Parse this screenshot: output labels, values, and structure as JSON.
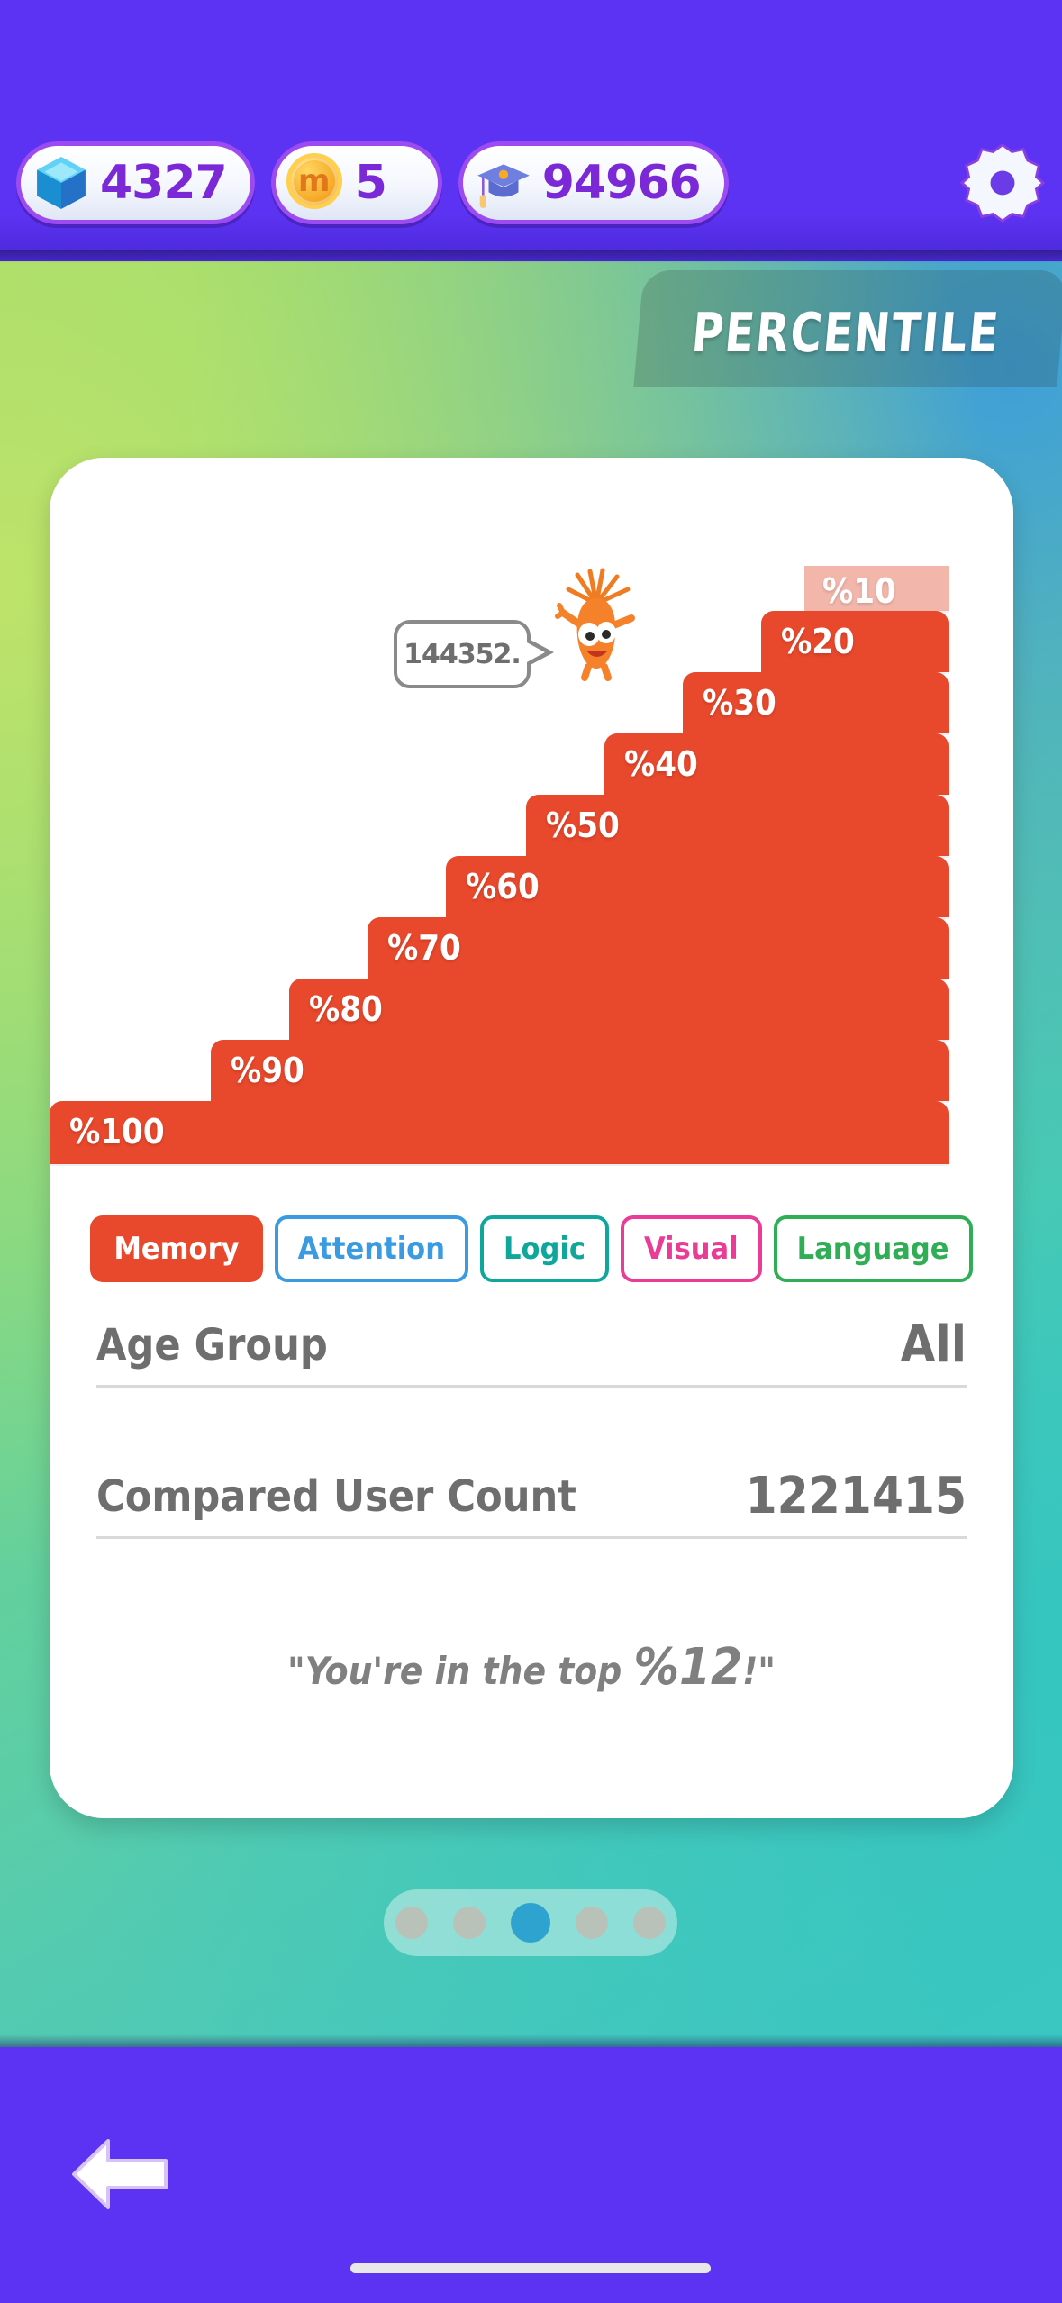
{
  "hud": {
    "gem": {
      "icon": "gem-icon",
      "value": "4327"
    },
    "coin": {
      "icon": "coin-icon",
      "glyph": "m",
      "value": "5"
    },
    "cap": {
      "icon": "graduation-cap-icon",
      "value": "94966"
    },
    "settings": {
      "icon": "gear-icon"
    }
  },
  "header": {
    "title": "PERCENTILE"
  },
  "chart_data": {
    "type": "bar",
    "title": "PERCENTILE",
    "orientation": "staircase",
    "categories": [
      "%10",
      "%20",
      "%30",
      "%40",
      "%50",
      "%60",
      "%70",
      "%80",
      "%90",
      "%100"
    ],
    "values": [
      10,
      20,
      30,
      40,
      50,
      60,
      70,
      80,
      90,
      100
    ],
    "highlight_category": "%10",
    "bar_color": "#E8482C",
    "faded_color": "#F3B6AB",
    "label_color": "#FFFFFF",
    "annotation": {
      "text": "144352.",
      "attached_to": "%10"
    },
    "xlabel": "",
    "ylabel": "",
    "grid": false,
    "legend": "none"
  },
  "bubble": {
    "text": "144352."
  },
  "mascot": {
    "icon": "carrot-mascot-icon"
  },
  "tabs": [
    {
      "label": "Memory",
      "color": "#E8482C",
      "active": true
    },
    {
      "label": "Attention",
      "color": "#3A9BE0",
      "active": false
    },
    {
      "label": "Logic",
      "color": "#0FA79B",
      "active": false
    },
    {
      "label": "Visual",
      "color": "#EA3C96",
      "active": false
    },
    {
      "label": "Language",
      "color": "#2FAE56",
      "active": false
    }
  ],
  "info": {
    "age_group_label": "Age Group",
    "age_group_value": "All",
    "compared_label": "Compared User Count",
    "compared_value": "1221415"
  },
  "quote": {
    "prefix": "\"You're in the top ",
    "value": "%12",
    "suffix": "!\""
  },
  "pager": {
    "count": 5,
    "active_index": 2
  },
  "bottom": {
    "back": "back-arrow-icon"
  }
}
